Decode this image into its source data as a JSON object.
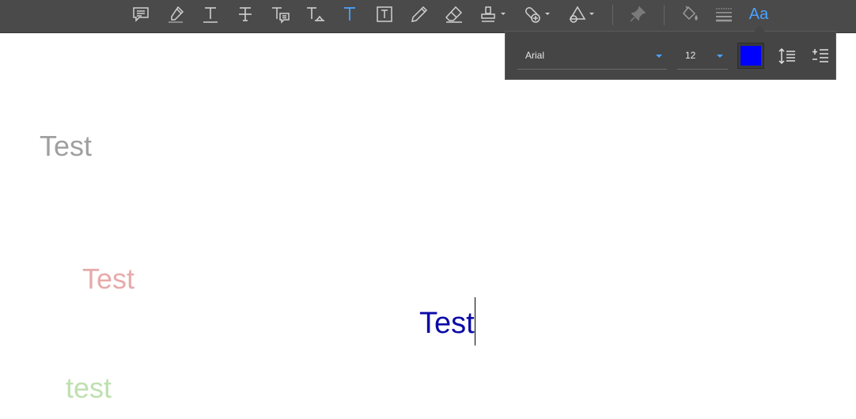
{
  "toolbar": {
    "tools": [
      {
        "name": "comment-icon"
      },
      {
        "name": "highlight-icon"
      },
      {
        "name": "underline-text-icon"
      },
      {
        "name": "strikethrough-text-icon"
      },
      {
        "name": "replace-text-icon"
      },
      {
        "name": "insert-text-icon"
      },
      {
        "name": "typewriter-text-icon",
        "active": true
      },
      {
        "name": "textbox-icon"
      },
      {
        "name": "pencil-icon"
      },
      {
        "name": "eraser-icon"
      },
      {
        "name": "stamp-icon"
      },
      {
        "name": "attach-icon"
      },
      {
        "name": "shapes-icon"
      },
      {
        "name": "pin-icon"
      },
      {
        "name": "fill-color-icon"
      },
      {
        "name": "line-style-icon"
      },
      {
        "name": "font-style-icon",
        "active": true
      }
    ],
    "font_button_label": "Aa",
    "colors": {
      "background": "#4a4a4a",
      "icon": "#d0d0d0",
      "active": "#4aa3ff",
      "disabled": "#7a7a7a"
    }
  },
  "font_panel": {
    "font_family_value": "Arial",
    "font_size_value": "12",
    "text_color": "#0000ff",
    "line_spacing_icon": "line-spacing-icon",
    "list_icon": "list-icon"
  },
  "canvas": {
    "annotations": [
      {
        "text": "Test",
        "color": "#a0a0a0"
      },
      {
        "text": "Test",
        "color": "#e8aaaa"
      },
      {
        "text": "Test",
        "color": "#0a0aa8"
      },
      {
        "text": "test",
        "color": "#bfe0b0"
      }
    ]
  }
}
